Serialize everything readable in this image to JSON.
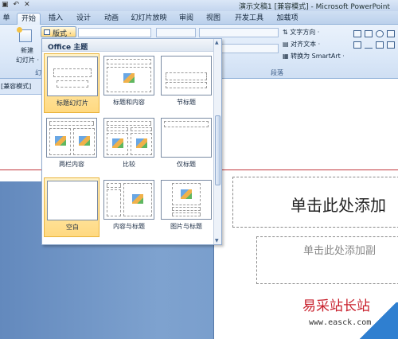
{
  "titlebar": {
    "title": "演示文稿1 [兼容模式] - Microsoft PowerPoint",
    "qat_icons": [
      "save-icon",
      "undo-icon",
      "close-icon"
    ]
  },
  "tabs": [
    "单",
    "开始",
    "插入",
    "设计",
    "动画",
    "幻灯片放映",
    "审阅",
    "视图",
    "开发工具",
    "加载项"
  ],
  "active_tab": "开始",
  "ribbon": {
    "new_slide_label_1": "新建",
    "new_slide_label_2": "幻灯片 ·",
    "layout_button": "版式 ·",
    "text_direction": "文字方向 ·",
    "align_text": "对齐文本 ·",
    "convert_smartart": "转换为 SmartArt ·",
    "paragraph_group": "段落",
    "slides_group_fragment": "幻"
  },
  "mode_indicator": "[兼容模式]",
  "layout_gallery": {
    "header": "Office 主题",
    "items": [
      {
        "label": "标题幻灯片",
        "selected": true
      },
      {
        "label": "标题和内容",
        "selected": false
      },
      {
        "label": "节标题",
        "selected": false
      },
      {
        "label": "两栏内容",
        "selected": false
      },
      {
        "label": "比较",
        "selected": false
      },
      {
        "label": "仅标题",
        "selected": false
      },
      {
        "label": "空白",
        "selected": true
      },
      {
        "label": "内容与标题",
        "selected": false
      },
      {
        "label": "图片与标题",
        "selected": false
      }
    ]
  },
  "slide": {
    "title_placeholder": "单击此处添加",
    "subtitle_placeholder": "单击此处添加副"
  },
  "watermark": {
    "name": "易采站长站",
    "url": "www.easck.com"
  }
}
